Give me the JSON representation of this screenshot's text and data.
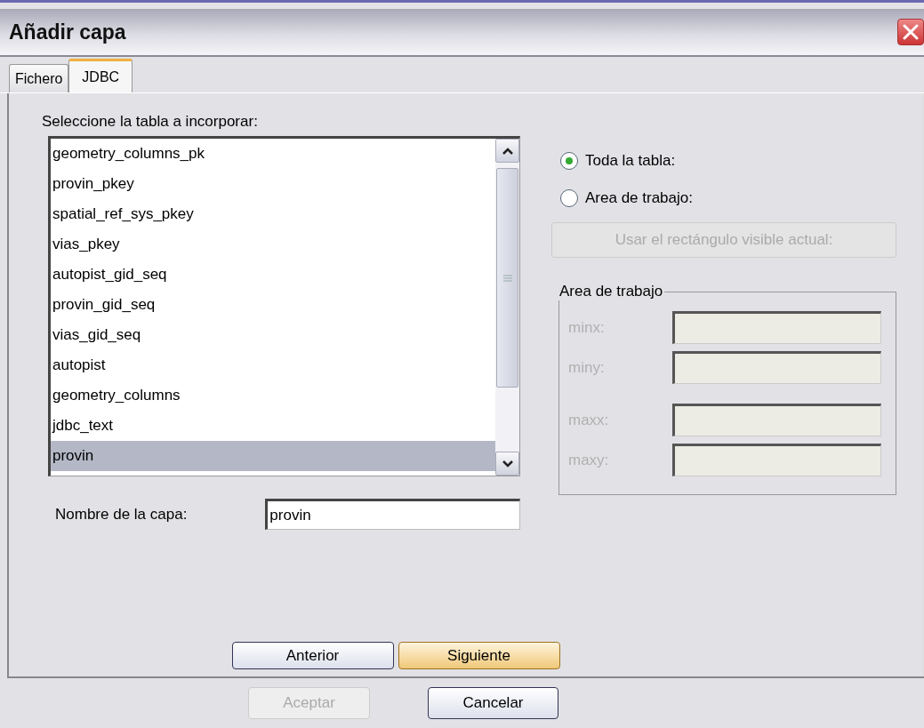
{
  "window": {
    "title": "Añadir capa"
  },
  "tabs": [
    {
      "label": "Fichero",
      "selected": false
    },
    {
      "label": "JDBC",
      "selected": true
    }
  ],
  "table_list": {
    "label": "Seleccione la tabla a incorporar:",
    "items": [
      {
        "label": "geometry_columns_pk",
        "selected": false
      },
      {
        "label": "provin_pkey",
        "selected": false
      },
      {
        "label": "spatial_ref_sys_pkey",
        "selected": false
      },
      {
        "label": "vias_pkey",
        "selected": false
      },
      {
        "label": "autopist_gid_seq",
        "selected": false
      },
      {
        "label": "provin_gid_seq",
        "selected": false
      },
      {
        "label": "vias_gid_seq",
        "selected": false
      },
      {
        "label": "autopist",
        "selected": false
      },
      {
        "label": "geometry_columns",
        "selected": false
      },
      {
        "label": "jdbc_text",
        "selected": false
      },
      {
        "label": "provin",
        "selected": true
      }
    ]
  },
  "extent_options": [
    {
      "label": "Toda la tabla:",
      "selected": true
    },
    {
      "label": "Area de trabajo:",
      "selected": false
    }
  ],
  "use_visible_button": {
    "label": "Usar el rectángulo visible actual:",
    "disabled": true
  },
  "work_area": {
    "title": "Area de trabajo",
    "field_groups": [
      [
        {
          "label": "minx:",
          "disabled": true
        },
        {
          "label": "miny:",
          "disabled": true
        }
      ],
      [
        {
          "label": "maxx:",
          "disabled": true
        },
        {
          "label": "maxy:",
          "disabled": true
        }
      ]
    ]
  },
  "layer_name": {
    "label": "Nombre de la capa:",
    "value": "provin"
  },
  "wizard_buttons": [
    {
      "label": "Anterior",
      "default": false
    },
    {
      "label": "Siguiente",
      "default": true
    }
  ],
  "dialog_buttons": [
    {
      "label": "Aceptar",
      "disabled": true
    },
    {
      "label": "Cancelar",
      "disabled": false
    }
  ]
}
